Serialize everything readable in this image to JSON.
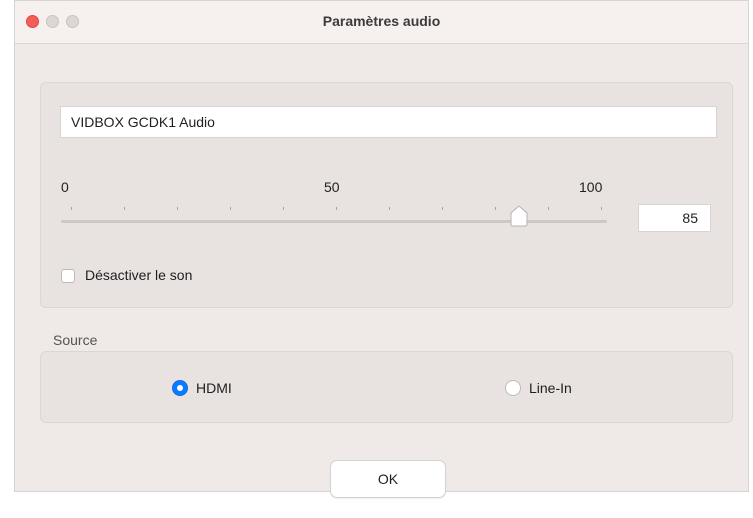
{
  "window": {
    "title": "Paramètres audio"
  },
  "audio": {
    "device_name": "VIDBOX GCDK1 Audio",
    "slider": {
      "min_label": "0",
      "mid_label": "50",
      "max_label": "100",
      "value": 85
    },
    "volume_value": "85",
    "mute_label": "Désactiver le son",
    "mute_checked": false
  },
  "source": {
    "label": "Source",
    "options": [
      {
        "label": "HDMI",
        "selected": true
      },
      {
        "label": "Line-In",
        "selected": false
      }
    ]
  },
  "buttons": {
    "ok_label": "OK"
  },
  "colors": {
    "accent": "#0a7bff",
    "close": "#f25f59"
  }
}
